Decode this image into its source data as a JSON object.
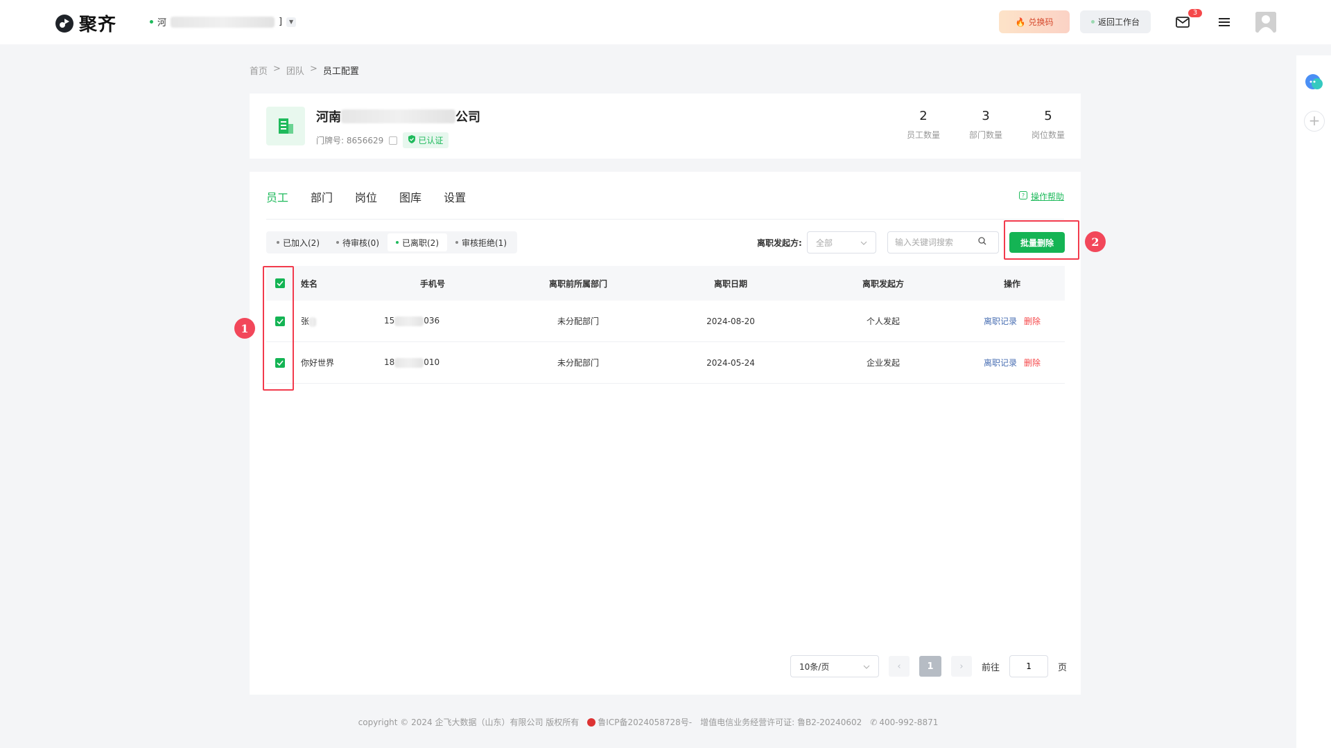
{
  "header": {
    "brand": "聚齐",
    "org_prefix": "河",
    "org_suffix": "]",
    "redeem_label": "兑换码",
    "back_label": "返回工作台",
    "mail_badge": "3"
  },
  "breadcrumb": [
    "首页",
    "团队",
    "员工配置"
  ],
  "company": {
    "name_prefix": "河南",
    "name_suffix": "公司",
    "door_label": "门牌号: 8656629",
    "verified_label": "已认证",
    "stats": [
      {
        "value": "2",
        "label": "员工数量"
      },
      {
        "value": "3",
        "label": "部门数量"
      },
      {
        "value": "5",
        "label": "岗位数量"
      }
    ]
  },
  "tabs": [
    "员工",
    "部门",
    "岗位",
    "图库",
    "设置"
  ],
  "help_label": "操作帮助",
  "filters": [
    "已加入(2)",
    "待审核(0)",
    "已离职(2)",
    "审核拒绝(1)"
  ],
  "initiator_filter": {
    "label": "离职发起方:",
    "value": "全部"
  },
  "search": {
    "placeholder": "输入关键词搜索"
  },
  "batch_delete_label": "批量删除",
  "table": {
    "headers": [
      "姓名",
      "手机号",
      "离职前所属部门",
      "离职日期",
      "离职发起方",
      "操作"
    ],
    "rows": [
      {
        "name": "张",
        "phone_prefix": "15",
        "phone_suffix": "036",
        "dept": "未分配部门",
        "date": "2024-08-20",
        "initiator": "个人发起",
        "op1": "离职记录",
        "op2": "删除"
      },
      {
        "name": "你好世界",
        "phone_prefix": "18",
        "phone_suffix": "010",
        "dept": "未分配部门",
        "date": "2024-05-24",
        "initiator": "企业发起",
        "op1": "离职记录",
        "op2": "删除"
      }
    ]
  },
  "pagination": {
    "page_size": "10条/页",
    "current": "1",
    "goto_label": "前往",
    "goto_value": "1",
    "page_label": "页"
  },
  "footer": {
    "copyright": "copyright © 2024 企飞大数据（山东）有限公司 版权所有",
    "icp": "鲁ICP备2024058728号-",
    "license": "增值电信业务经营许可证: 鲁B2-20240602",
    "phone": "400-992-8871"
  },
  "annotations": [
    "1",
    "2"
  ],
  "colors": {
    "accent": "#1fba5c",
    "danger": "#f5484a",
    "annotation": "#f23a4c"
  }
}
